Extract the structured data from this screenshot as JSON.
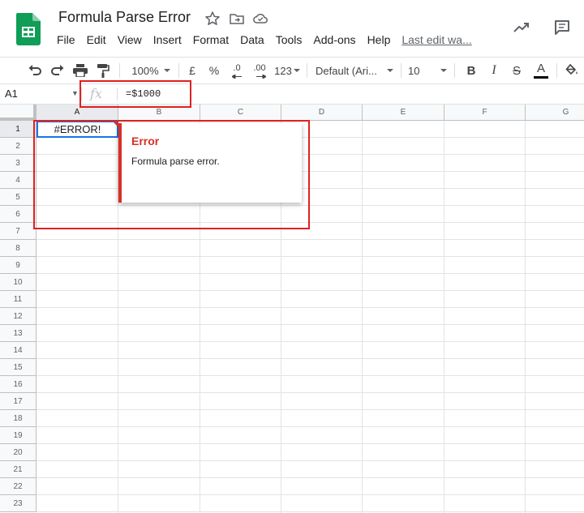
{
  "header": {
    "title": "Formula Parse Error",
    "menu": [
      "File",
      "Edit",
      "View",
      "Insert",
      "Format",
      "Data",
      "Tools",
      "Add-ons",
      "Help"
    ],
    "last_edit": "Last edit wa..."
  },
  "toolbar": {
    "zoom": "100%",
    "currency": "£",
    "percent": "%",
    "dec_decrease": ".0",
    "dec_increase": ".00",
    "number_format": "123",
    "font": "Default (Ari...",
    "font_size": "10",
    "bold": "B",
    "italic": "I",
    "strike": "S",
    "text_color_label": "A"
  },
  "formula_bar": {
    "name_box": "A1",
    "fx": "fx",
    "formula": "=$1000"
  },
  "grid": {
    "columns": [
      "A",
      "B",
      "C",
      "D",
      "E",
      "F",
      "G"
    ],
    "rows": [
      "1",
      "2",
      "3",
      "4",
      "5",
      "6",
      "7",
      "8",
      "9",
      "10",
      "11",
      "12",
      "13",
      "14",
      "15",
      "16",
      "17",
      "18",
      "19",
      "20",
      "21",
      "22",
      "23"
    ],
    "cell_a1": "#ERROR!"
  },
  "error_popup": {
    "title": "Error",
    "message": "Formula parse error."
  },
  "colors": {
    "sheets_green": "#0f9d58",
    "error_red": "#d93025",
    "selection_blue": "#1a73e8",
    "highlight_red": "#e02020"
  }
}
